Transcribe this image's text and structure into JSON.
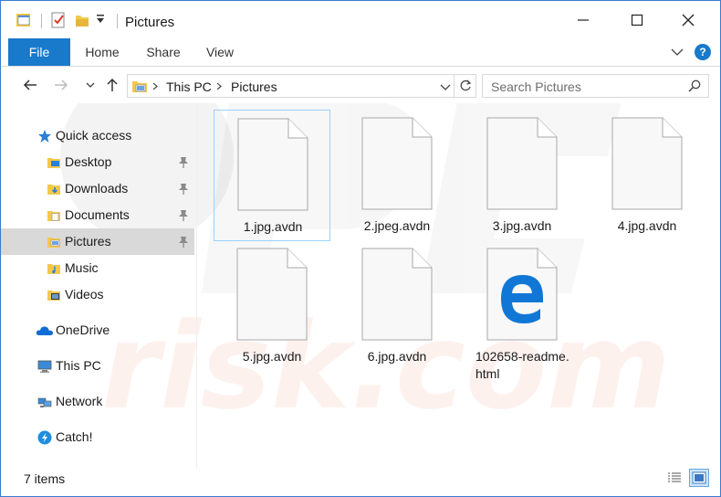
{
  "window": {
    "title": "Pictures",
    "controls": {
      "minimize": "—",
      "maximize": "☐",
      "close": "✕"
    }
  },
  "ribbon": {
    "tabs": [
      "File",
      "Home",
      "Share",
      "View"
    ],
    "help": "?"
  },
  "address": {
    "breadcrumbs": [
      "This PC",
      "Pictures"
    ],
    "search_placeholder": "Search Pictures"
  },
  "nav": {
    "items": [
      {
        "label": "Quick access",
        "icon": "star-icon",
        "pinned": false
      },
      {
        "label": "Desktop",
        "icon": "desktop-folder-icon",
        "pinned": true
      },
      {
        "label": "Downloads",
        "icon": "downloads-folder-icon",
        "pinned": true
      },
      {
        "label": "Documents",
        "icon": "documents-folder-icon",
        "pinned": true
      },
      {
        "label": "Pictures",
        "icon": "pictures-folder-icon",
        "pinned": true,
        "selected": true
      },
      {
        "label": "Music",
        "icon": "music-folder-icon",
        "pinned": false
      },
      {
        "label": "Videos",
        "icon": "videos-folder-icon",
        "pinned": false
      },
      {
        "label": "OneDrive",
        "icon": "onedrive-icon",
        "pinned": false
      },
      {
        "label": "This PC",
        "icon": "computer-icon",
        "pinned": false
      },
      {
        "label": "Network",
        "icon": "network-icon",
        "pinned": false
      },
      {
        "label": "Catch!",
        "icon": "catch-icon",
        "pinned": false
      }
    ]
  },
  "files": [
    {
      "name": "1.jpg.avdn",
      "icon": "blank-file-icon"
    },
    {
      "name": "2.jpeg.avdn",
      "icon": "blank-file-icon"
    },
    {
      "name": "3.jpg.avdn",
      "icon": "blank-file-icon"
    },
    {
      "name": "4.jpg.avdn",
      "icon": "blank-file-icon"
    },
    {
      "name": "5.jpg.avdn",
      "icon": "blank-file-icon"
    },
    {
      "name": "6.jpg.avdn",
      "icon": "blank-file-icon"
    },
    {
      "name": "102658-readme.html",
      "name_line1": "102658-readme.",
      "name_line2": "html",
      "icon": "edge-html-file-icon"
    }
  ],
  "status": {
    "item_count": "7 items"
  },
  "watermark": {
    "text": "PC risk.com"
  },
  "colors": {
    "accent": "#1979ca",
    "selected_nav": "#d9d9d9",
    "watermark": "#e8491e"
  }
}
